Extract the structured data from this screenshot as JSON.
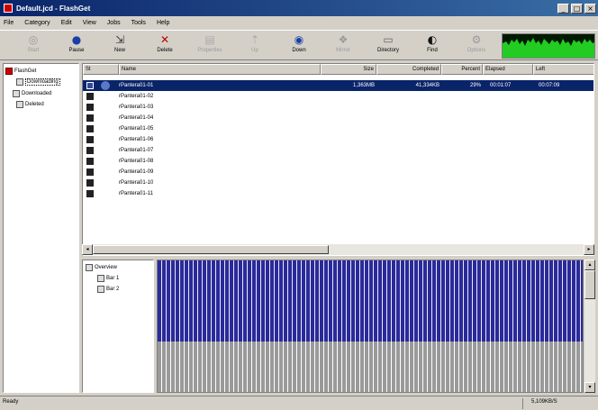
{
  "window": {
    "title": "Default.jcd - FlashGet",
    "minimize": "_",
    "maximize": "□",
    "close": "×"
  },
  "menu": [
    "File",
    "Category",
    "Edit",
    "View",
    "Jobs",
    "Tools",
    "Help"
  ],
  "toolbar": [
    {
      "label": "Start",
      "icon": "start-icon",
      "glyph": "◎",
      "enabled": false
    },
    {
      "label": "Pause",
      "icon": "pause-icon",
      "glyph": "●",
      "enabled": true
    },
    {
      "label": "New",
      "icon": "new-icon",
      "glyph": "⇲",
      "enabled": true
    },
    {
      "label": "Delete",
      "icon": "delete-icon",
      "glyph": "✕",
      "enabled": true
    },
    {
      "label": "Properties",
      "icon": "properties-icon",
      "glyph": "▤",
      "enabled": false
    },
    {
      "label": "Up",
      "icon": "up-icon",
      "glyph": "⇡",
      "enabled": false
    },
    {
      "label": "Down",
      "icon": "down-icon",
      "glyph": "◉",
      "enabled": true
    },
    {
      "label": "Mirror",
      "icon": "mirror-icon",
      "glyph": "❖",
      "enabled": false
    },
    {
      "label": "Directory",
      "icon": "directory-icon",
      "glyph": "▭",
      "enabled": true
    },
    {
      "label": "Find",
      "icon": "find-icon",
      "glyph": "◐",
      "enabled": true
    },
    {
      "label": "Options",
      "icon": "options-icon",
      "glyph": "⚙",
      "enabled": false
    }
  ],
  "tree": [
    {
      "label": "FlashGet",
      "icon": "flashget-icon",
      "selected": false
    },
    {
      "label": "Downloading",
      "icon": "downloading-icon",
      "selected": true
    },
    {
      "label": "Downloaded",
      "icon": "downloaded-icon",
      "selected": false
    },
    {
      "label": "Deleted",
      "icon": "deleted-icon",
      "selected": false
    }
  ],
  "columns": [
    "St",
    "Name",
    "Size",
    "Completed",
    "Percent",
    "Elapsed",
    "Left"
  ],
  "rows": [
    {
      "name": "rPantera01-01",
      "size": "1,363MB",
      "completed": "41,334KB",
      "percent": "29%",
      "elapsed": "00:01:07",
      "left": "00:07:09",
      "selected": true
    },
    {
      "name": "rPantera01-02",
      "selected": false
    },
    {
      "name": "rPantera01-03",
      "selected": false
    },
    {
      "name": "rPantera01-04",
      "selected": false
    },
    {
      "name": "rPantera01-05",
      "selected": false
    },
    {
      "name": "rPantera01-06",
      "selected": false
    },
    {
      "name": "rPantera01-07",
      "selected": false
    },
    {
      "name": "rPantera01-08",
      "selected": false
    },
    {
      "name": "rPantera01-09",
      "selected": false
    },
    {
      "name": "rPantera01-10",
      "selected": false
    },
    {
      "name": "rPantera01-11",
      "selected": false
    }
  ],
  "parts_tree": {
    "root": "Overview",
    "children": [
      "Bar 1",
      "Bar 2"
    ]
  },
  "status": {
    "left": "Ready",
    "right": "5,109KB/S"
  },
  "colors": {
    "titlebar": "#0a246a",
    "selection": "#0a246a",
    "block_done": "#2a2a9a",
    "block_pending": "#9a9a9a",
    "graph": "#22cc22"
  }
}
